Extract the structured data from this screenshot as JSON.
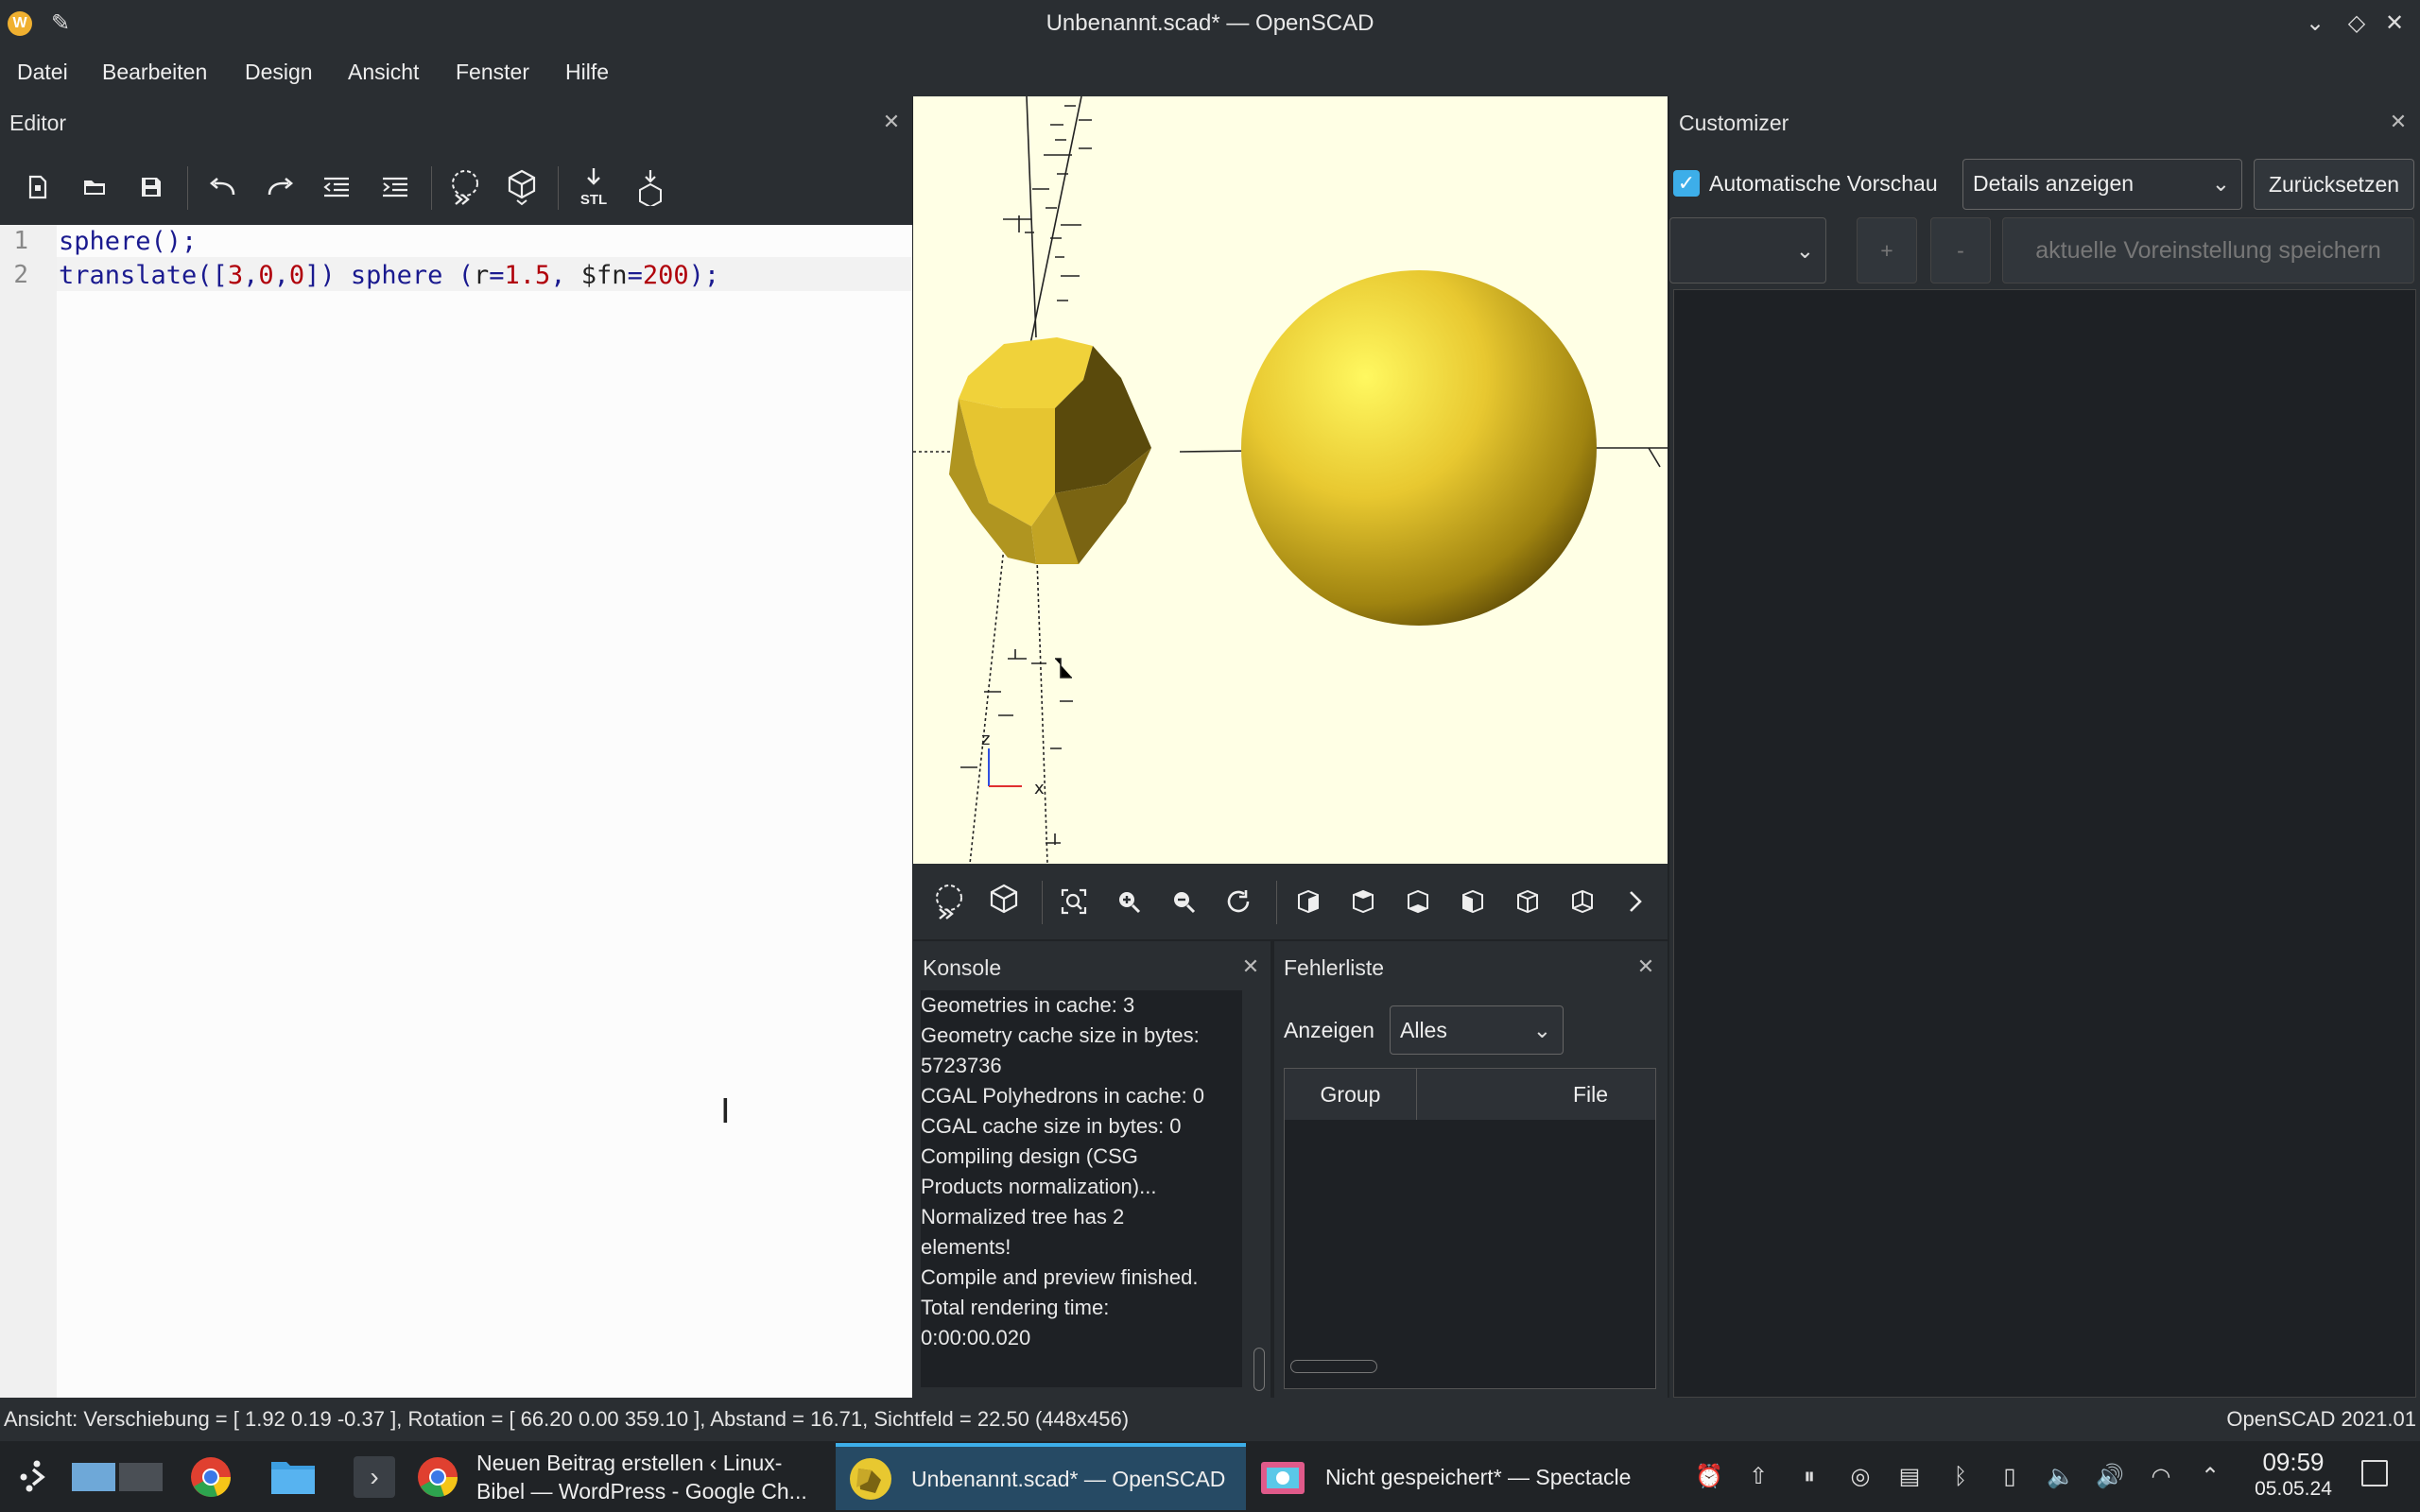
{
  "window": {
    "title": "Unbenannt.scad* — OpenSCAD",
    "app_icon_letter": "W"
  },
  "menu": [
    "Datei",
    "Bearbeiten",
    "Design",
    "Ansicht",
    "Fenster",
    "Hilfe"
  ],
  "editor": {
    "title": "Editor",
    "line_numbers": [
      "1",
      "2"
    ],
    "line1": {
      "kw": "sphere",
      "rest": "();"
    },
    "line2": {
      "a": "translate([",
      "n1": "3",
      "c1": ",",
      "n2": "0",
      "c2": ",",
      "n3": "0",
      "b": "]) sphere (",
      "v1": "r",
      "eq1": "=",
      "n4": "1.5",
      "c3": ", ",
      "v2": "$fn",
      "eq2": "=",
      "n5": "200",
      "end": ");"
    },
    "toolbar_icons": [
      "new-file-icon",
      "open-file-icon",
      "save-icon",
      "undo-icon",
      "redo-icon",
      "unindent-icon",
      "indent-icon",
      "preview-icon",
      "render-icon",
      "export-stl-icon",
      "send-to-printer-icon"
    ],
    "stl_label": "STL"
  },
  "viewport": {
    "axis_labels": {
      "z": "z",
      "x": "x"
    },
    "model_color": "#e8c830"
  },
  "view_toolbar_icons": [
    "preview-icon",
    "render-icon",
    "view-all-icon",
    "zoom-in-icon",
    "zoom-out-icon",
    "reset-view-icon",
    "view-right-icon",
    "view-top-icon",
    "view-bottom-icon",
    "view-left-icon",
    "view-front-icon",
    "view-back-icon",
    "more-chevron-icon"
  ],
  "console": {
    "title": "Konsole",
    "lines": [
      "Geometries in cache: 3",
      "Geometry cache size in bytes:",
      "5723736",
      "CGAL Polyhedrons in cache: 0",
      "CGAL cache size in bytes: 0",
      "Compiling design (CSG",
      "Products normalization)...",
      "Normalized tree has 2",
      "elements!",
      "Compile and preview finished.",
      "Total rendering time:",
      "0:00:00.020"
    ]
  },
  "errorlist": {
    "title": "Fehlerliste",
    "show_label": "Anzeigen",
    "filter_value": "Alles",
    "columns": [
      "Group",
      "File"
    ]
  },
  "customizer": {
    "title": "Customizer",
    "auto_preview_label": "Automatische Vorschau",
    "auto_preview_checked": true,
    "details_value": "Details anzeigen",
    "reset_label": "Zurücksetzen",
    "preset_value": "",
    "add_label": "+",
    "remove_label": "-",
    "save_preset_label": "aktuelle Voreinstellung speichern"
  },
  "statusbar": {
    "view_info": "Ansicht: Verschiebung = [ 1.92 0.19 -0.37 ], Rotation = [ 66.20 0.00 359.10 ], Abstand = 16.71, Sichtfeld = 22.50 (448x456)",
    "version": "OpenSCAD 2021.01"
  },
  "taskbar": {
    "tasks": [
      {
        "label_1": "Neuen Beitrag erstellen ‹ Linux-",
        "label_2": "Bibel — WordPress - Google Ch..."
      },
      {
        "label_1": "Unbenannt.scad* — OpenSCAD"
      },
      {
        "label_1": "Nicht gespeichert* — Spectacle"
      }
    ],
    "time": "09:59",
    "date": "05.05.24"
  }
}
